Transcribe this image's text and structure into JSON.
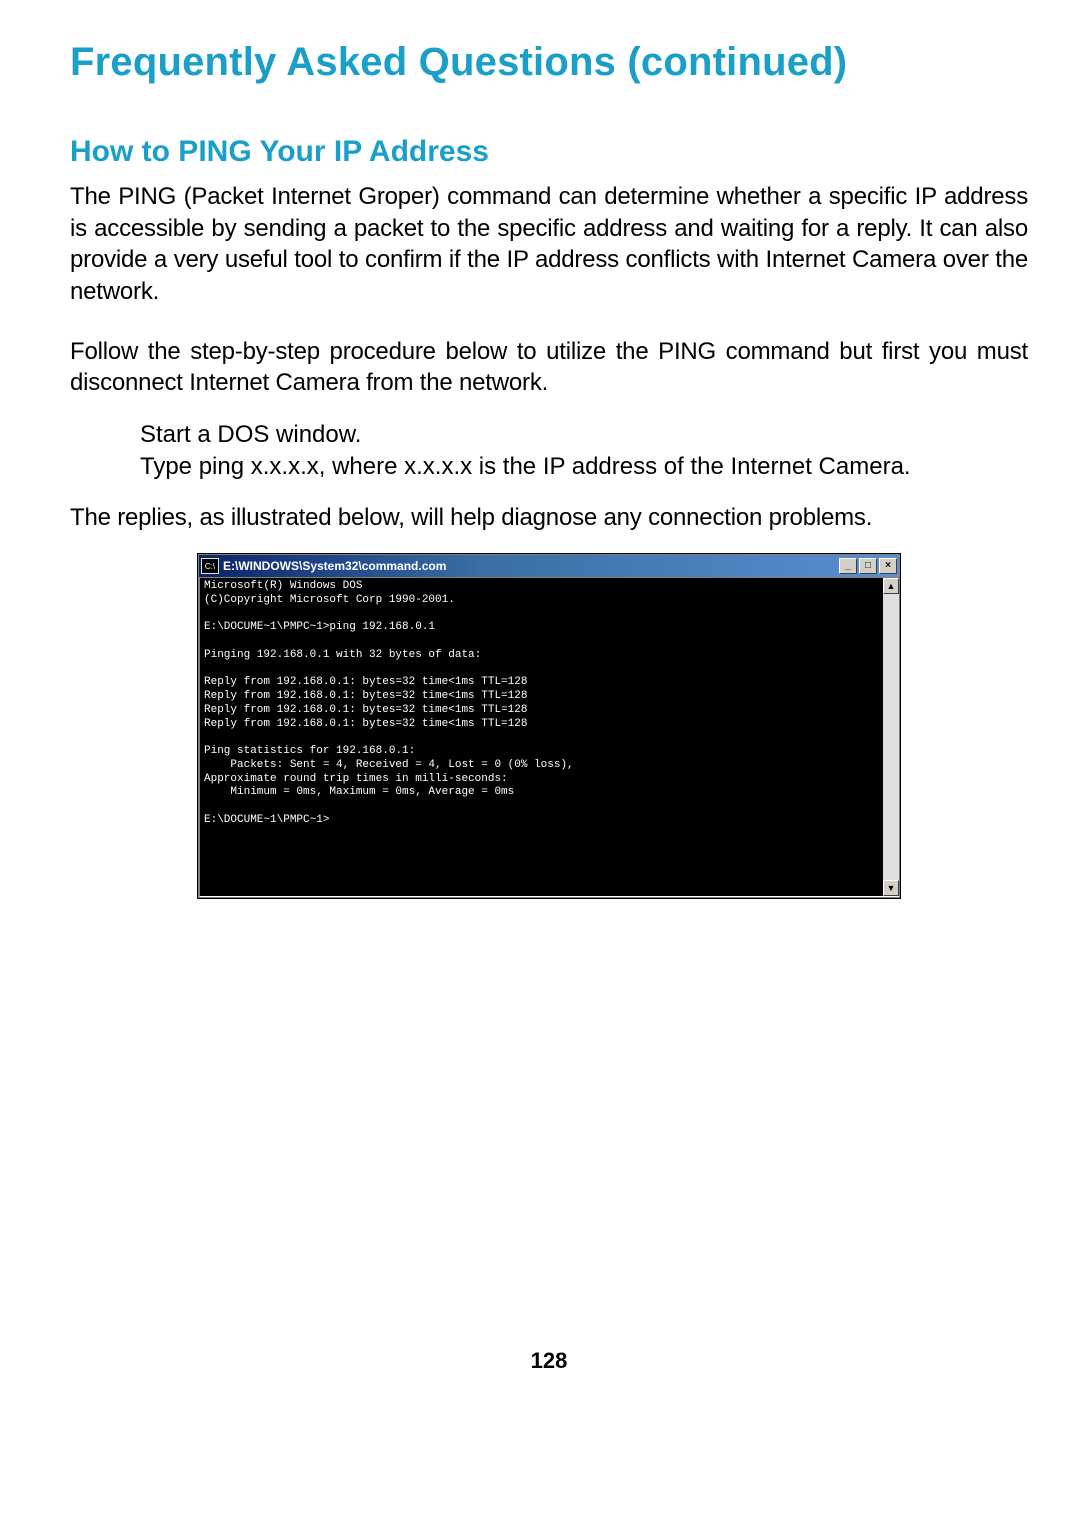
{
  "title": "Frequently Asked Questions (continued)",
  "subtitle": "How to PING Your IP Address",
  "para1": "The PING (Packet Internet Groper) command can determine whether a specific IP address is accessible by sending a packet to the specific address and waiting for a reply. It can also provide a very useful tool to confirm if the IP address conflicts with Internet Camera over the network.",
  "para2": "Follow the step-by-step procedure below to utilize the PING command but first you must disconnect Internet Camera from the network.",
  "step1": "Start a DOS window.",
  "step2": "Type ping x.x.x.x, where x.x.x.x is the IP address of the Internet Camera.",
  "para3": "The replies, as illustrated below, will help diagnose any connection problems.",
  "dos": {
    "icon": "C:\\",
    "title": "E:\\WINDOWS\\System32\\command.com",
    "minimize": "_",
    "maximize": "□",
    "close": "×",
    "scroll_up": "▲",
    "scroll_down": "▼",
    "content": "Microsoft(R) Windows DOS\n(C)Copyright Microsoft Corp 1990-2001.\n\nE:\\DOCUME~1\\PMPC~1>ping 192.168.0.1\n\nPinging 192.168.0.1 with 32 bytes of data:\n\nReply from 192.168.0.1: bytes=32 time<1ms TTL=128\nReply from 192.168.0.1: bytes=32 time<1ms TTL=128\nReply from 192.168.0.1: bytes=32 time<1ms TTL=128\nReply from 192.168.0.1: bytes=32 time<1ms TTL=128\n\nPing statistics for 192.168.0.1:\n    Packets: Sent = 4, Received = 4, Lost = 0 (0% loss),\nApproximate round trip times in milli-seconds:\n    Minimum = 0ms, Maximum = 0ms, Average = 0ms\n\nE:\\DOCUME~1\\PMPC~1>"
  },
  "page_number": "128"
}
